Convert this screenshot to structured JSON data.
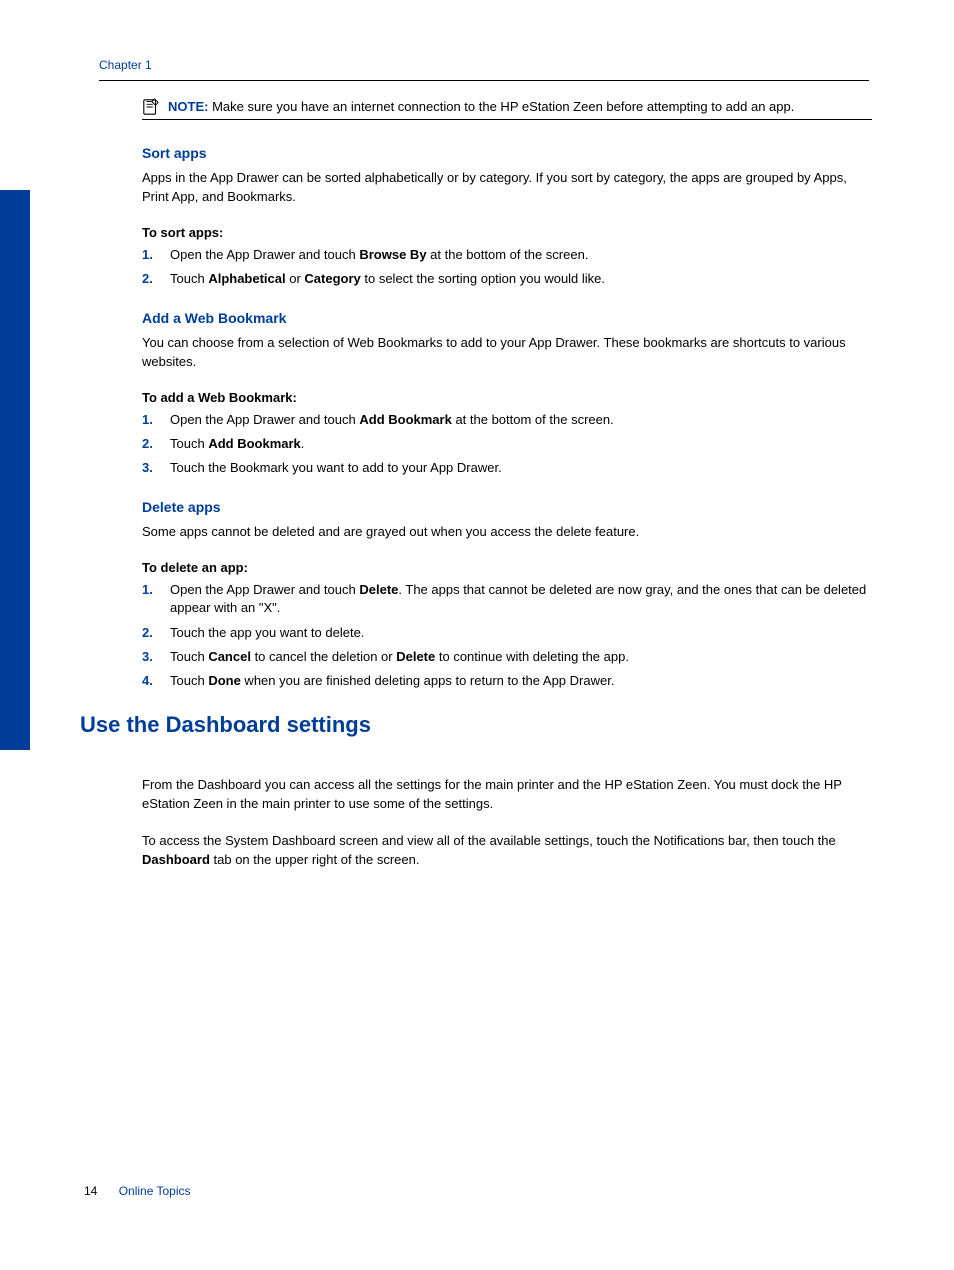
{
  "header": {
    "chapter": "Chapter 1"
  },
  "sidebar": {
    "tab_label": "Online Topics"
  },
  "note": {
    "label": "NOTE:",
    "text": "Make sure you have an internet connection to the HP eStation Zeen before attempting to add an app."
  },
  "sort_apps": {
    "heading": "Sort apps",
    "intro": "Apps in the App Drawer can be sorted alphabetically or by category. If you sort by category, the apps are grouped by Apps, Print App, and Bookmarks.",
    "steps_title": "To sort apps:",
    "step1_a": "Open the App Drawer and touch ",
    "step1_b": "Browse By",
    "step1_c": " at the bottom of the screen.",
    "step2_a": "Touch ",
    "step2_b": "Alphabetical",
    "step2_c": " or ",
    "step2_d": "Category",
    "step2_e": " to select the sorting option you would like."
  },
  "add_bookmark": {
    "heading": "Add a Web Bookmark",
    "intro": "You can choose from a selection of Web Bookmarks to add to your App Drawer. These bookmarks are shortcuts to various websites.",
    "steps_title": "To add a Web Bookmark:",
    "step1_a": "Open the App Drawer and touch ",
    "step1_b": "Add Bookmark",
    "step1_c": " at the bottom of the screen.",
    "step2_a": "Touch ",
    "step2_b": "Add Bookmark",
    "step2_c": ".",
    "step3": "Touch the Bookmark you want to add to your App Drawer."
  },
  "delete_apps": {
    "heading": "Delete apps",
    "intro": "Some apps cannot be deleted and are grayed out when you access the delete feature.",
    "steps_title": "To delete an app:",
    "step1_a": "Open the App Drawer and touch ",
    "step1_b": "Delete",
    "step1_c": ". The apps that cannot be deleted are now gray, and the ones that can be deleted appear with an \"X\".",
    "step2": "Touch the app you want to delete.",
    "step3_a": "Touch ",
    "step3_b": "Cancel",
    "step3_c": " to cancel the deletion or ",
    "step3_d": "Delete",
    "step3_e": " to continue with deleting the app.",
    "step4_a": "Touch ",
    "step4_b": "Done",
    "step4_c": " when you are finished deleting apps to return to the App Drawer."
  },
  "dashboard": {
    "heading": "Use the Dashboard settings",
    "p1": "From the Dashboard you can access all the settings for the main printer and the HP eStation Zeen. You must dock the HP eStation Zeen in the main printer to use some of the settings.",
    "p2_a": "To access the System Dashboard screen and view all of the available settings, touch the Notifications bar, then touch the ",
    "p2_b": "Dashboard",
    "p2_c": " tab on the upper right of the screen."
  },
  "footer": {
    "page": "14",
    "title": "Online Topics"
  }
}
